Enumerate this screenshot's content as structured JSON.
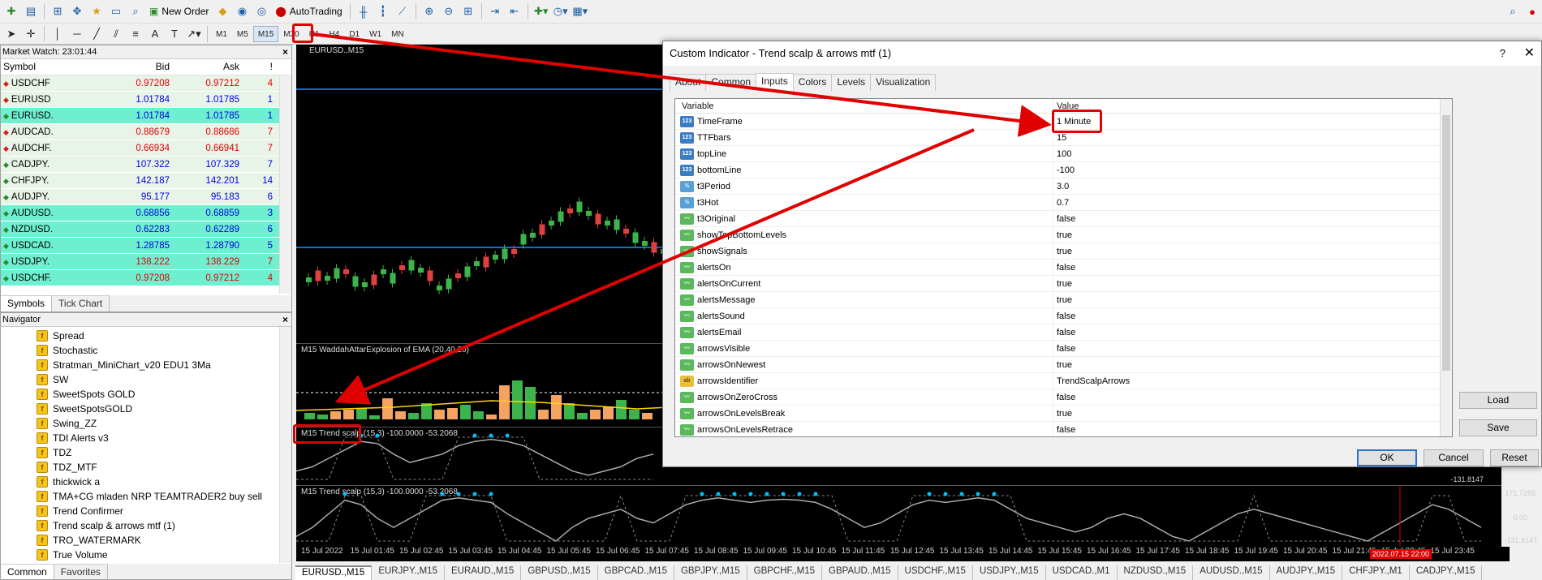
{
  "toolbar": {
    "new_order": "New Order",
    "autotrading": "AutoTrading",
    "timeframes": [
      "M1",
      "M5",
      "M15",
      "M30",
      "H1",
      "H4",
      "D1",
      "W1",
      "MN"
    ],
    "selected_timeframe": "M15"
  },
  "market_watch": {
    "title": "Market Watch: 23:01:44",
    "columns": [
      "Symbol",
      "Bid",
      "Ask",
      "!"
    ],
    "rows": [
      {
        "symbol": "USDCHF",
        "bid": "0.97208",
        "ask": "0.97212",
        "spread": "4",
        "dir": "down",
        "bg": "#e8f4e8",
        "color": "#e00000"
      },
      {
        "symbol": "EURUSD",
        "bid": "1.01784",
        "ask": "1.01785",
        "spread": "1",
        "dir": "down",
        "bg": "#e8f4e8",
        "color": "#0000e0"
      },
      {
        "symbol": "EURUSD.",
        "bid": "1.01784",
        "ask": "1.01785",
        "spread": "1",
        "dir": "up",
        "bg": "#6ef0d0",
        "color": "#0000e0"
      },
      {
        "symbol": "AUDCAD.",
        "bid": "0.88679",
        "ask": "0.88686",
        "spread": "7",
        "dir": "down",
        "bg": "#e8f4e8",
        "color": "#e00000"
      },
      {
        "symbol": "AUDCHF.",
        "bid": "0.66934",
        "ask": "0.66941",
        "spread": "7",
        "dir": "down",
        "bg": "#e8f4e8",
        "color": "#e00000"
      },
      {
        "symbol": "CADJPY.",
        "bid": "107.322",
        "ask": "107.329",
        "spread": "7",
        "dir": "up",
        "bg": "#e8f4e8",
        "color": "#0000e0"
      },
      {
        "symbol": "CHFJPY.",
        "bid": "142.187",
        "ask": "142.201",
        "spread": "14",
        "dir": "up",
        "bg": "#e8f4e8",
        "color": "#0000e0"
      },
      {
        "symbol": "AUDJPY.",
        "bid": "95.177",
        "ask": "95.183",
        "spread": "6",
        "dir": "up",
        "bg": "#e8f4e8",
        "color": "#0000e0"
      },
      {
        "symbol": "AUDUSD.",
        "bid": "0.68856",
        "ask": "0.68859",
        "spread": "3",
        "dir": "up",
        "bg": "#6ef0d0",
        "color": "#0000e0"
      },
      {
        "symbol": "NZDUSD.",
        "bid": "0.62283",
        "ask": "0.62289",
        "spread": "6",
        "dir": "up",
        "bg": "#6ef0d0",
        "color": "#0000e0"
      },
      {
        "symbol": "USDCAD.",
        "bid": "1.28785",
        "ask": "1.28790",
        "spread": "5",
        "dir": "up",
        "bg": "#6ef0d0",
        "color": "#0000e0"
      },
      {
        "symbol": "USDJPY.",
        "bid": "138.222",
        "ask": "138.229",
        "spread": "7",
        "dir": "up",
        "bg": "#6ef0d0",
        "color": "#e00000"
      },
      {
        "symbol": "USDCHF.",
        "bid": "0.97208",
        "ask": "0.97212",
        "spread": "4",
        "dir": "up",
        "bg": "#6ef0d0",
        "color": "#e00000"
      }
    ],
    "tabs": [
      "Symbols",
      "Tick Chart"
    ]
  },
  "navigator": {
    "title": "Navigator",
    "items": [
      "Spread",
      "Stochastic",
      "Stratman_MiniChart_v20 EDU1 3Ma",
      "SW",
      "SweetSpots GOLD",
      "SweetSpotsGOLD",
      "Swing_ZZ",
      "TDI Alerts v3",
      "TDZ",
      "TDZ_MTF",
      "thickwick a",
      "TMA+CG mladen NRP TEAMTRADER2 buy sell",
      "Trend Confirmer",
      "Trend scalp & arrows mtf (1)",
      "TRO_WATERMARK",
      "True Volume"
    ],
    "tabs": [
      "Common",
      "Favorites"
    ]
  },
  "chart": {
    "main_label": "EURUSD.,M15",
    "sub1_label": "M15 WaddahAttarExplosion of EMA (20,40,20)",
    "sub2_label": "M15 Trend scalp (15,3) -100.0000 -53.2068",
    "sub3_label": "M15 Trend scalp (15,3) -100.0000 -53.2068",
    "sub3_levels": [
      "171.7265",
      "0.00",
      "-131.8147"
    ],
    "sub2_level": "-131.8147",
    "highlight_time": "2022.07.15 22:00",
    "x_labels": [
      "15 Jul 2022",
      "15 Jul 01:45",
      "15 Jul 02:45",
      "15 Jul 03:45",
      "15 Jul 04:45",
      "15 Jul 05:45",
      "15 Jul 06:45",
      "15 Jul 07:45",
      "15 Jul 08:45",
      "15 Jul 09:45",
      "15 Jul 10:45",
      "15 Jul 11:45",
      "15 Jul 12:45",
      "15 Jul 13:45",
      "15 Jul 14:45",
      "15 Jul 15:45",
      "15 Jul 16:45",
      "15 Jul 17:45",
      "15 Jul 18:45",
      "15 Jul 19:45",
      "15 Jul 20:45",
      "15 Jul 21:45",
      "15 Jul 22:45",
      "15 Jul 23:45"
    ]
  },
  "chart_tabs": [
    "EURUSD.,M15",
    "EURJPY.,M15",
    "EURAUD.,M15",
    "GBPUSD.,M15",
    "GBPCAD.,M15",
    "GBPJPY.,M15",
    "GBPCHF.,M15",
    "GBPAUD.,M15",
    "USDCHF.,M15",
    "USDJPY.,M15",
    "USDCAD.,M1",
    "NZDUSD.,M15",
    "AUDUSD.,M15",
    "AUDJPY.,M15",
    "CHFJPY.,M1",
    "CADJPY.,M15"
  ],
  "dialog": {
    "title": "Custom Indicator - Trend scalp & arrows mtf (1)",
    "help": "?",
    "tabs": [
      "About",
      "Common",
      "Inputs",
      "Colors",
      "Levels",
      "Visualization"
    ],
    "active_tab": "Inputs",
    "columns": [
      "Variable",
      "Value"
    ],
    "params": [
      {
        "name": "TimeFrame",
        "value": "1 Minute",
        "type": "int"
      },
      {
        "name": "TTFbars",
        "value": "15",
        "type": "int"
      },
      {
        "name": "topLine",
        "value": "100",
        "type": "int"
      },
      {
        "name": "bottomLine",
        "value": "-100",
        "type": "int"
      },
      {
        "name": "t3Period",
        "value": "3.0",
        "type": "dbl"
      },
      {
        "name": "t3Hot",
        "value": "0.7",
        "type": "dbl"
      },
      {
        "name": "t3Original",
        "value": "false",
        "type": "bool"
      },
      {
        "name": "showTopBottomLevels",
        "value": "true",
        "type": "bool"
      },
      {
        "name": "showSignals",
        "value": "true",
        "type": "bool"
      },
      {
        "name": "alertsOn",
        "value": "false",
        "type": "bool"
      },
      {
        "name": "alertsOnCurrent",
        "value": "true",
        "type": "bool"
      },
      {
        "name": "alertsMessage",
        "value": "true",
        "type": "bool"
      },
      {
        "name": "alertsSound",
        "value": "false",
        "type": "bool"
      },
      {
        "name": "alertsEmail",
        "value": "false",
        "type": "bool"
      },
      {
        "name": "arrowsVisible",
        "value": "false",
        "type": "bool"
      },
      {
        "name": "arrowsOnNewest",
        "value": "true",
        "type": "bool"
      },
      {
        "name": "arrowsIdentifier",
        "value": "TrendScalpArrows",
        "type": "str"
      },
      {
        "name": "arrowsOnZeroCross",
        "value": "false",
        "type": "bool"
      },
      {
        "name": "arrowsOnLevelsBreak",
        "value": "true",
        "type": "bool"
      },
      {
        "name": "arrowsOnLevelsRetrace",
        "value": "false",
        "type": "bool"
      }
    ],
    "buttons": {
      "load": "Load",
      "save": "Save",
      "ok": "OK",
      "cancel": "Cancel",
      "reset": "Reset"
    }
  },
  "colors": {
    "accent": "#e00000",
    "bull": "#3cb44b",
    "bear": "#e04040",
    "signal": "#00bfff"
  }
}
